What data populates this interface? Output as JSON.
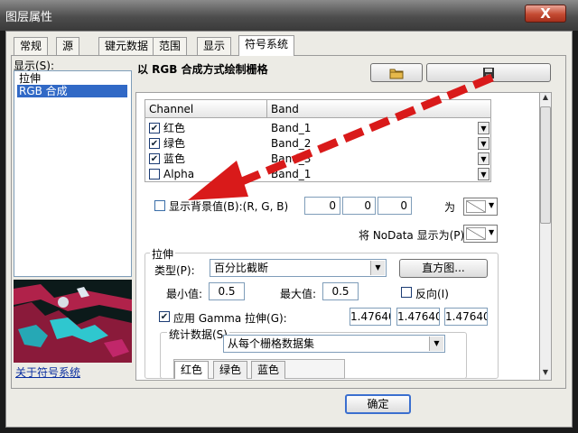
{
  "window": {
    "title": "图层属性",
    "close_label": "X"
  },
  "tabs": [
    "常规",
    "源",
    "键元数据",
    "范围",
    "显示",
    "符号系统"
  ],
  "left": {
    "label": "显示(S):",
    "items": [
      "拉伸",
      "RGB 合成"
    ],
    "link": "关于符号系统"
  },
  "heading": "以 RGB 合成方式绘制栅格",
  "table": {
    "headers": [
      "Channel",
      "Band"
    ],
    "rows": [
      {
        "channel": "红色",
        "band": "Band_1",
        "checked": true
      },
      {
        "channel": "绿色",
        "band": "Band_2",
        "checked": true
      },
      {
        "channel": "蓝色",
        "band": "Band_3",
        "checked": true
      },
      {
        "channel": "Alpha",
        "band": "Band_1",
        "checked": false
      }
    ]
  },
  "background": {
    "label": "显示背景值(B):(R, G, B)",
    "values": [
      "0",
      "0",
      "0"
    ],
    "as_label": "为",
    "nodata_label": "将 NoData 显示为(P)"
  },
  "stretch": {
    "group_label": "拉伸",
    "type_label": "类型(P):",
    "type_value": "百分比截断",
    "histogram_button": "直方图...",
    "min_label": "最小值:",
    "min_value": "0.5",
    "max_label": "最大值:",
    "max_value": "0.5",
    "invert_label": "反向(I)",
    "gamma_label": "应用 Gamma 拉伸(G):",
    "gamma_values": [
      "1.47640",
      "1.47640",
      "1.47640"
    ],
    "stats_label": "统计数据(S)",
    "stats_value": "从每个栅格数据集",
    "subtabs": [
      "红色",
      "绿色",
      "蓝色"
    ]
  },
  "footer": {
    "ok_label": "确定"
  }
}
